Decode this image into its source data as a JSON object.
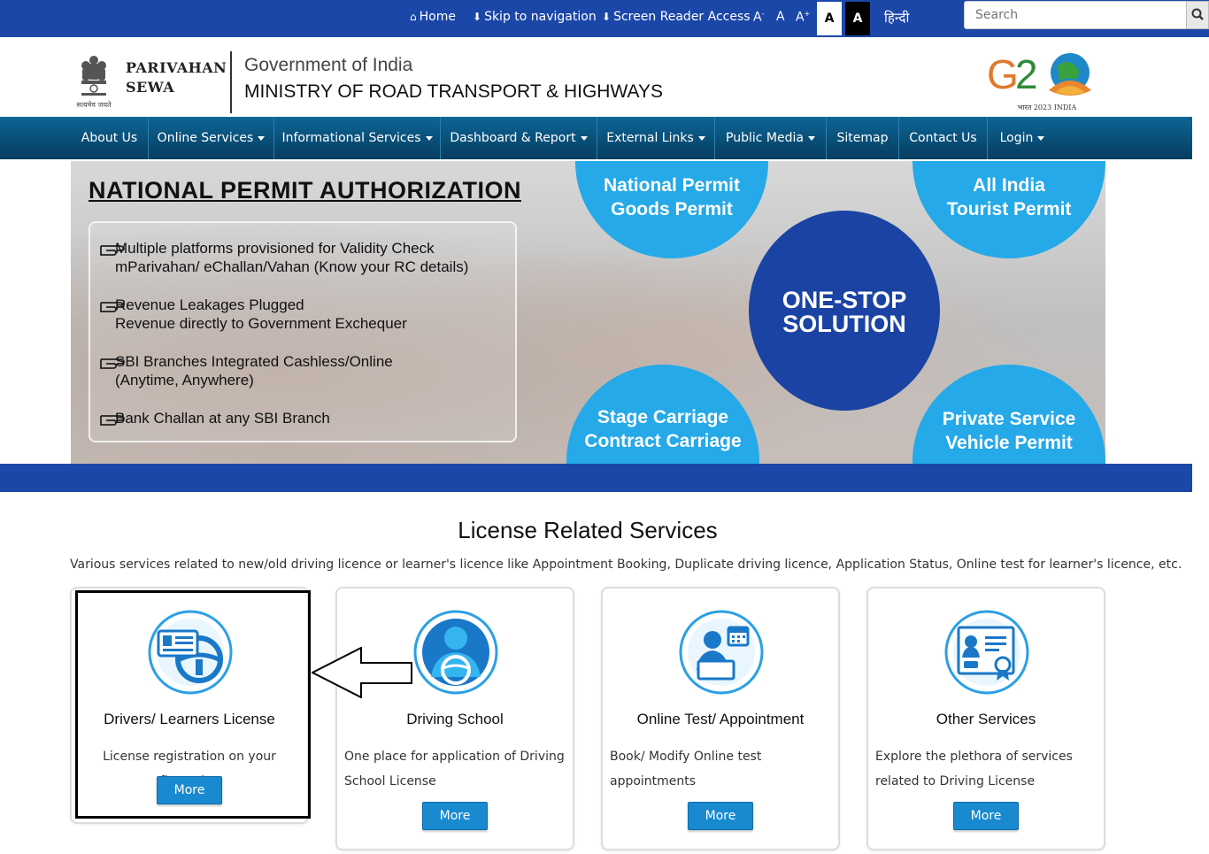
{
  "topbar": {
    "home": "Home",
    "skip": "Skip to navigation",
    "screen_reader": "Screen Reader Access",
    "font_decrease": "A",
    "font_normal": "A",
    "font_increase": "A",
    "theme_light": "A",
    "theme_dark": "A",
    "hindi": "हिन्दी",
    "search_placeholder": "Search"
  },
  "header": {
    "brand_line1": "PARIVAHAN",
    "brand_line2": "SEWA",
    "emblem_motto": "सत्यमेव जयते",
    "gov": "Government of India",
    "ministry": "MINISTRY OF ROAD TRANSPORT & HIGHWAYS",
    "g20_caption": "भारत 2023 INDIA"
  },
  "nav": {
    "items": [
      {
        "label": "About Us",
        "dropdown": false
      },
      {
        "label": "Online Services",
        "dropdown": true
      },
      {
        "label": "Informational Services",
        "dropdown": true
      },
      {
        "label": "Dashboard & Report",
        "dropdown": true
      },
      {
        "label": "External Links",
        "dropdown": true
      },
      {
        "label": "Public Media",
        "dropdown": true
      },
      {
        "label": "Sitemap",
        "dropdown": false
      },
      {
        "label": "Contact Us",
        "dropdown": false
      },
      {
        "label": "Login",
        "dropdown": true
      }
    ]
  },
  "banner": {
    "title": "NATIONAL PERMIT AUTHORIZATION",
    "points": [
      {
        "line1": "Multiple platforms provisioned for Validity Check",
        "line2": "mParivahan/ eChallan/Vahan (Know your RC details)"
      },
      {
        "line1": "Revenue Leakages Plugged",
        "line2": "Revenue directly to Government Exchequer"
      },
      {
        "line1": "SBI Branches Integrated Cashless/Online",
        "line2": "(Anytime, Anywhere)"
      },
      {
        "line1": "Bank Challan at any SBI Branch",
        "line2": ""
      }
    ],
    "circles": {
      "national_permit": [
        "National Permit",
        "Goods Permit"
      ],
      "tourist": [
        "All India",
        "Tourist Permit"
      ],
      "onestop": [
        "ONE-STOP",
        "SOLUTION"
      ],
      "stage": [
        "Stage Carriage",
        "Contract Carriage"
      ],
      "private": [
        "Private Service",
        "Vehicle Permit"
      ]
    }
  },
  "section": {
    "title": "License Related Services",
    "description": "Various services related to new/old driving licence or learner's licence like Appointment Booking, Duplicate driving licence, Application Status, Online test for learner's licence, etc."
  },
  "cards": [
    {
      "title": "Drivers/ Learners License",
      "description": "License registration on your fingertips",
      "button": "More",
      "icon": "license-card-steering-icon"
    },
    {
      "title": "Driving School",
      "description": "One place for application of Driving School License",
      "button": "More",
      "icon": "driver-steering-icon"
    },
    {
      "title": "Online Test/ Appointment",
      "description": "Book/ Modify Online test appointments",
      "button": "More",
      "icon": "person-laptop-calendar-icon"
    },
    {
      "title": "Other Services",
      "description": "Explore the plethora of services related to Driving License",
      "button": "More",
      "icon": "certificate-icon"
    }
  ],
  "colors": {
    "topbar": "#1b47a8",
    "nav": "#0d6597",
    "accent": "#25a9e8",
    "onestop": "#1a43a3",
    "button": "#1a8ad0"
  }
}
